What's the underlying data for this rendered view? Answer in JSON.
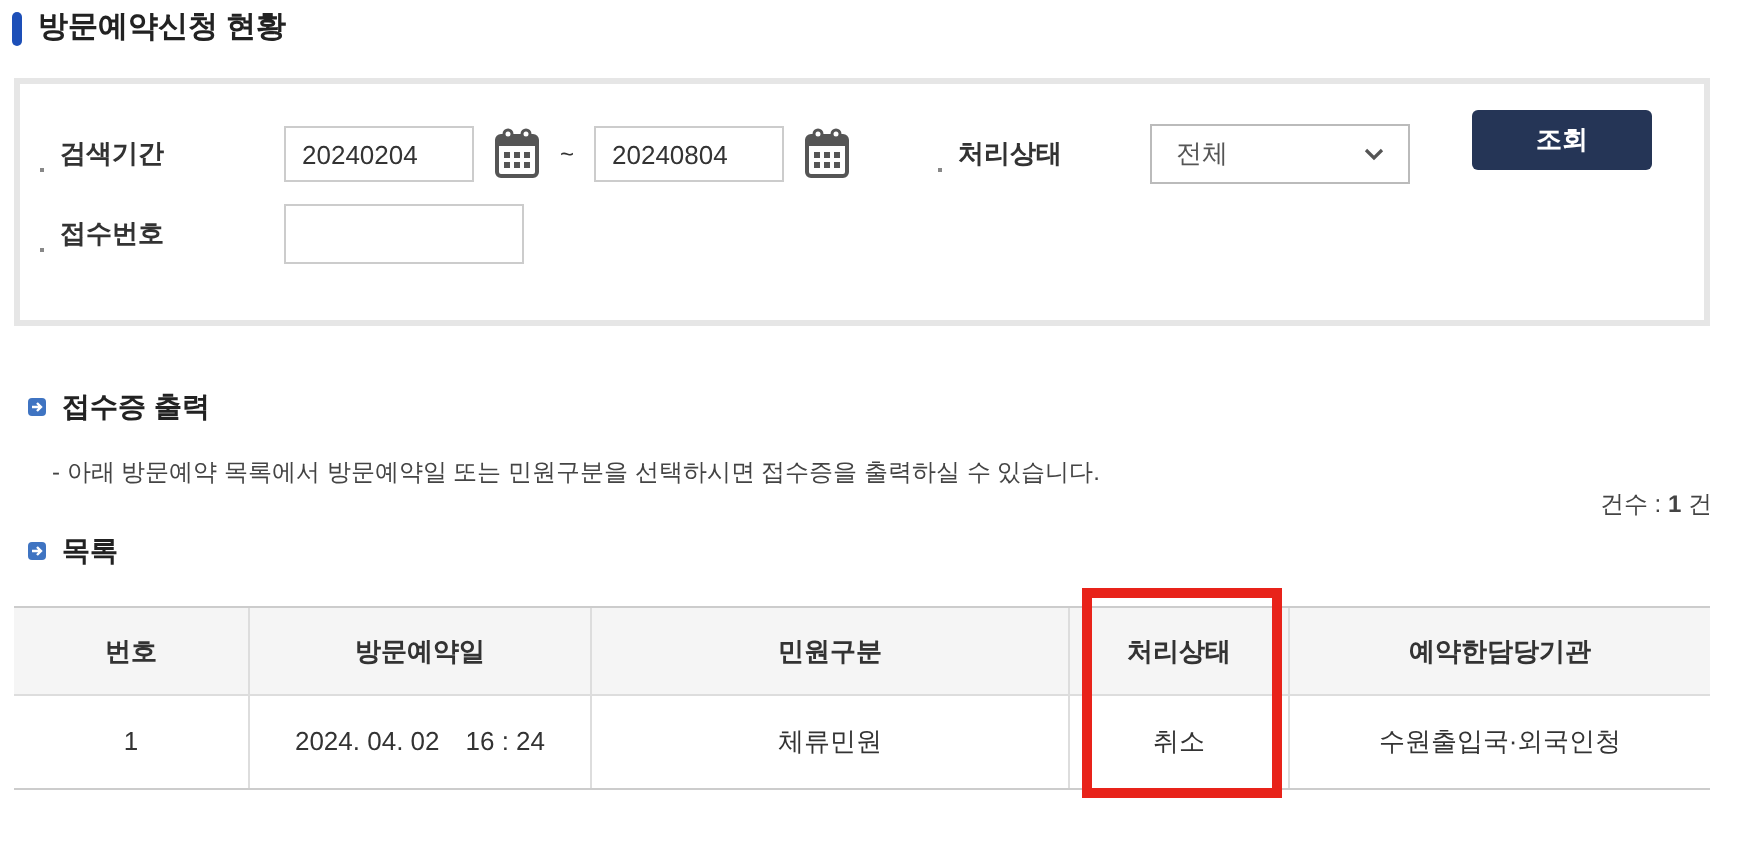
{
  "title": "방문예약신청 현황",
  "search": {
    "period_label": "검색기간",
    "date_from": "20240204",
    "separator": "~",
    "date_to": "20240804",
    "status_label": "처리상태",
    "status_value": "전체",
    "receipt_label": "접수번호",
    "button": "조회"
  },
  "receipt_section": {
    "heading": "접수증 출력",
    "note": "- 아래 방문예약 목록에서 방문예약일 또는 민원구분을 선택하시면 접수증을 출력하실 수 있습니다."
  },
  "count": "건수 : **1** 건",
  "list_heading": "목록",
  "table": {
    "columns": [
      {
        "label": "번호",
        "highlighted": false
      },
      {
        "label": "방문예약일",
        "highlighted": false
      },
      {
        "label": "민원구분",
        "highlighted": false
      },
      {
        "label": "처리상태",
        "highlighted": true
      },
      {
        "label": "예약한담당기관",
        "highlighted": false
      }
    ],
    "rows": [
      [
        "1",
        "2024. 04. 02　16 : 24",
        "체류민원",
        "취소",
        "수원출입국·외국인청"
      ]
    ]
  }
}
